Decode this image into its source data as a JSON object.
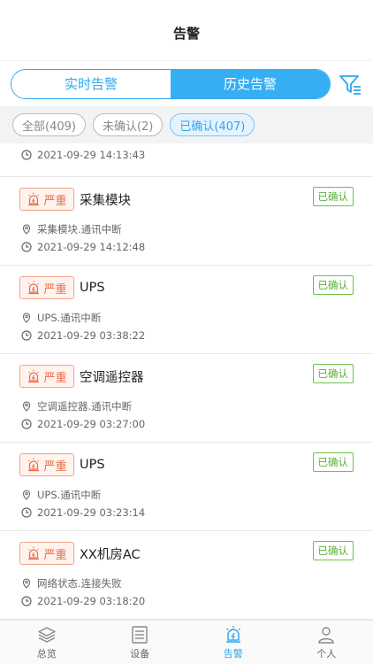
{
  "header": {
    "title": "告警"
  },
  "segment": {
    "realtime": "实时告警",
    "history": "历史告警"
  },
  "filters": [
    "全部(409)",
    "未确认(2)",
    "已确认(407)"
  ],
  "partial_time": "2021-09-29 14:13:43",
  "alarms": [
    {
      "severity": "严重",
      "name": "采集模块",
      "status": "已确认",
      "location": "采集模块.通讯中断",
      "time": "2021-09-29 14:12:48"
    },
    {
      "severity": "严重",
      "name": "UPS",
      "status": "已确认",
      "location": "UPS.通讯中断",
      "time": "2021-09-29 03:38:22"
    },
    {
      "severity": "严重",
      "name": "空调遥控器",
      "status": "已确认",
      "location": "空调遥控器.通讯中断",
      "time": "2021-09-29 03:27:00"
    },
    {
      "severity": "严重",
      "name": "UPS",
      "status": "已确认",
      "location": "UPS.通讯中断",
      "time": "2021-09-29 03:23:14"
    },
    {
      "severity": "严重",
      "name": "XX机房AC",
      "status": "已确认",
      "location": "网络状态.连接失败",
      "time": "2021-09-29 03:18:20"
    }
  ],
  "nav": {
    "overview": "总览",
    "devices": "设备",
    "alarm": "告警",
    "personal": "个人"
  },
  "colors": {
    "accent": "#35aef4",
    "severity": "#ea6b45",
    "confirmed": "#5bb13a"
  }
}
